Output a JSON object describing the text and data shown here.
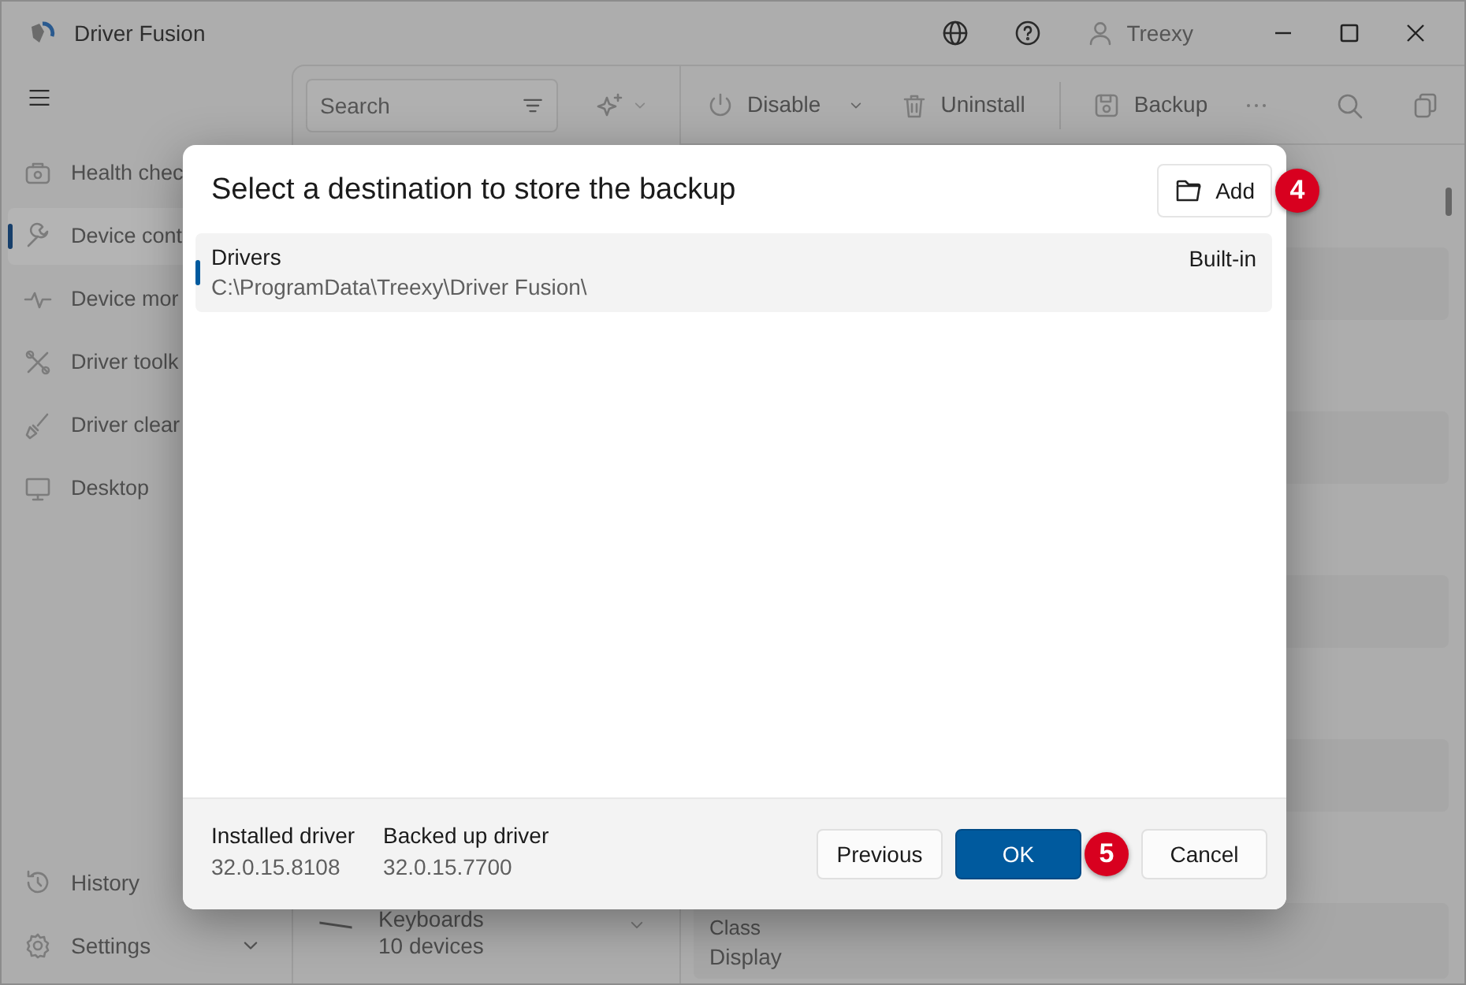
{
  "window": {
    "title": "Driver Fusion",
    "user": "Treexy"
  },
  "sidebar": {
    "items": [
      {
        "label": "Health chec",
        "selected": false
      },
      {
        "label": "Device cont",
        "selected": true
      },
      {
        "label": "Device mor",
        "selected": false
      },
      {
        "label": "Driver toolk",
        "selected": false
      },
      {
        "label": "Driver clear",
        "selected": false
      },
      {
        "label": "Desktop",
        "selected": false
      }
    ],
    "footer_items": [
      {
        "label": "History"
      },
      {
        "label": "Settings",
        "expandable": true
      }
    ]
  },
  "toolbar": {
    "search": {
      "placeholder": "Search"
    },
    "actions": [
      {
        "label": "Disable",
        "dropdown": true
      },
      {
        "label": "Uninstall"
      },
      {
        "label": "Backup"
      }
    ]
  },
  "device_list": [
    {
      "name": "Keyboards",
      "count": "10 devices"
    }
  ],
  "details": {
    "fields": [
      {
        "label": "Class",
        "value": "Display"
      }
    ]
  },
  "dialog": {
    "title": "Select a destination to store the backup",
    "add_button": {
      "label": "Add",
      "step": "4"
    },
    "destinations": [
      {
        "name": "Drivers",
        "path": "C:\\ProgramData\\Treexy\\Driver Fusion\\",
        "tag": "Built-in",
        "selected": true
      }
    ],
    "footer_info": [
      {
        "label": "Installed driver",
        "value": "32.0.15.8108"
      },
      {
        "label": "Backed up driver",
        "value": "32.0.15.7700"
      }
    ],
    "buttons": [
      {
        "label": "Previous",
        "kind": "secondary"
      },
      {
        "label": "OK",
        "kind": "primary",
        "step": "5"
      },
      {
        "label": "Cancel",
        "kind": "secondary"
      }
    ]
  }
}
